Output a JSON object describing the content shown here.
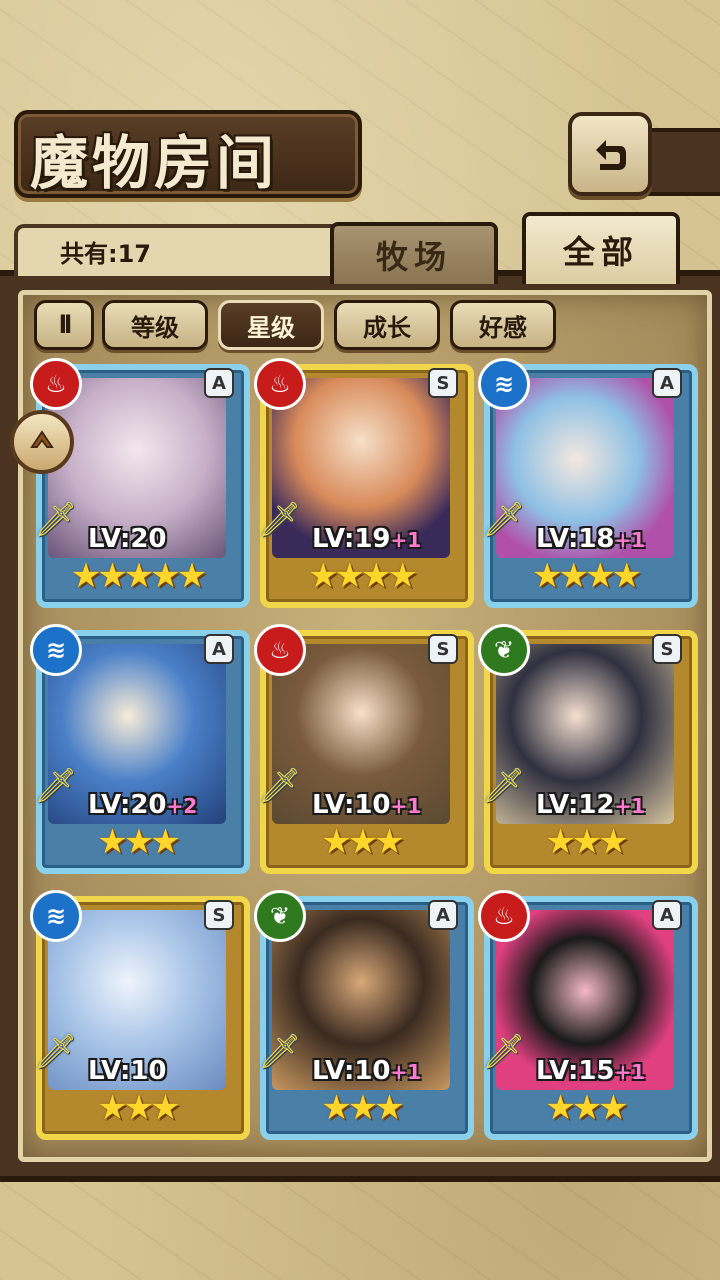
{
  "title": "魔物房间",
  "count_label": "共有:17",
  "tabs": [
    {
      "label": "牧场"
    },
    {
      "label": "全部"
    }
  ],
  "filters": {
    "sort_icon": "ll",
    "items": [
      {
        "label": "等级"
      },
      {
        "label": "星级"
      },
      {
        "label": "成长"
      },
      {
        "label": "好感"
      }
    ]
  },
  "monsters": [
    {
      "element": "fire",
      "rank": "A",
      "lv": "LV:20",
      "plus": "",
      "stars": "★★★★★"
    },
    {
      "element": "fire",
      "rank": "S",
      "lv": "LV:19",
      "plus": "+1",
      "stars": "★★★★"
    },
    {
      "element": "water",
      "rank": "A",
      "lv": "LV:18",
      "plus": "+1",
      "stars": "★★★★"
    },
    {
      "element": "water",
      "rank": "A",
      "lv": "LV:20",
      "plus": "+2",
      "stars": "★★★"
    },
    {
      "element": "fire",
      "rank": "S",
      "lv": "LV:10",
      "plus": "+1",
      "stars": "★★★"
    },
    {
      "element": "grass",
      "rank": "S",
      "lv": "LV:12",
      "plus": "+1",
      "stars": "★★★"
    },
    {
      "element": "water",
      "rank": "S",
      "lv": "LV:10",
      "plus": "",
      "stars": "★★★"
    },
    {
      "element": "grass",
      "rank": "A",
      "lv": "LV:10",
      "plus": "+1",
      "stars": "★★★"
    },
    {
      "element": "fire",
      "rank": "A",
      "lv": "LV:15",
      "plus": "+1",
      "stars": "★★★"
    }
  ]
}
